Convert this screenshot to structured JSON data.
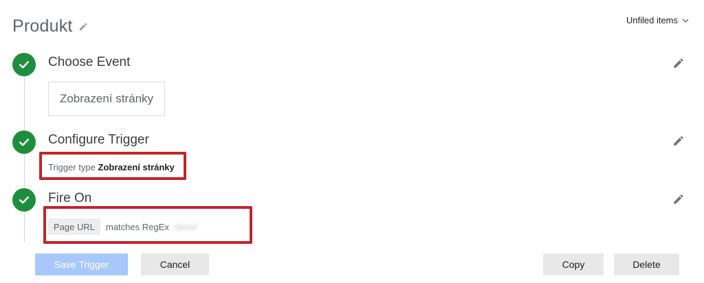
{
  "header": {
    "title": "Produkt",
    "folder_label": "Unfiled items"
  },
  "steps": [
    {
      "title": "Choose Event",
      "event_value": "Zobrazení stránky"
    },
    {
      "title": "Configure Trigger",
      "type_label": "Trigger type",
      "type_value": "Zobrazení stránky"
    },
    {
      "title": "Fire On",
      "condition_variable": "Page URL",
      "condition_operator": "matches RegEx",
      "condition_value": "/detail"
    }
  ],
  "footer": {
    "save_label": "Save Trigger",
    "cancel_label": "Cancel",
    "copy_label": "Copy",
    "delete_label": "Delete"
  },
  "colors": {
    "check_green": "#1e8e3e",
    "highlight_red": "#c0252b",
    "save_disabled_blue": "#a8c7fa"
  },
  "icons": {
    "title_edit": "pencil-icon",
    "step_edit": "pencil-icon",
    "step_done": "check-circle-icon",
    "folder_dropdown": "chevron-down-icon"
  }
}
